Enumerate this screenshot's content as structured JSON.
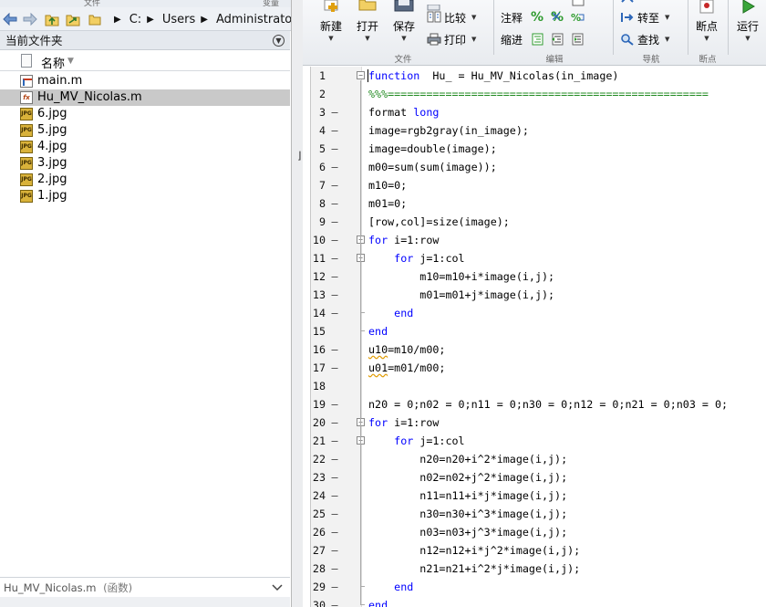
{
  "browser": {
    "top_labels": [
      "文件",
      "变量"
    ],
    "path": [
      "C:",
      "Users",
      "Administrator",
      "D"
    ],
    "folder_header": "当前文件夹",
    "column_name": "名称",
    "files": [
      {
        "name": "main.m",
        "icon": "m-file-icon",
        "selected": false
      },
      {
        "name": "Hu_MV_Nicolas.m",
        "icon": "function-file-icon",
        "selected": true
      },
      {
        "name": "6.jpg",
        "icon": "jpg-file-icon",
        "selected": false
      },
      {
        "name": "5.jpg",
        "icon": "jpg-file-icon",
        "selected": false
      },
      {
        "name": "4.jpg",
        "icon": "jpg-file-icon",
        "selected": false
      },
      {
        "name": "3.jpg",
        "icon": "jpg-file-icon",
        "selected": false
      },
      {
        "name": "2.jpg",
        "icon": "jpg-file-icon",
        "selected": false
      },
      {
        "name": "1.jpg",
        "icon": "jpg-file-icon",
        "selected": false
      }
    ],
    "details_name": "Hu_MV_Nicolas.m",
    "details_type": "(函数)"
  },
  "ribbon": {
    "new_label": "新建",
    "open_label": "打开",
    "save_label": "保存",
    "compare_label": "比较",
    "print_label": "打印",
    "comment_label": "注释",
    "indent_label": "缩进",
    "goto_label": "转至",
    "find_label": "查找",
    "breakpoints_label": "断点",
    "run_label": "运行",
    "group_file": "文件",
    "group_edit": "编辑",
    "group_nav": "导航",
    "group_bp": "断点",
    "percent_glyph": "%"
  },
  "icons": {
    "back": "back-arrow-icon",
    "forward": "forward-arrow-icon",
    "up": "up-folder-icon",
    "browse": "browse-folder-icon",
    "folder": "folder-icon"
  },
  "code": [
    {
      "n": "1",
      "bp": "",
      "fold": "box",
      "t": [
        [
          "kw",
          "function"
        ],
        [
          "",
          "  Hu_ = Hu_MV_Nicolas(in_image)"
        ]
      ]
    },
    {
      "n": "2",
      "bp": "",
      "fold": "line",
      "t": [
        [
          "cm",
          "%%%=================================================="
        ]
      ]
    },
    {
      "n": "3",
      "bp": "–",
      "fold": "line",
      "t": [
        [
          "",
          "format "
        ],
        [
          "kw",
          "long"
        ]
      ]
    },
    {
      "n": "4",
      "bp": "–",
      "fold": "line",
      "t": [
        [
          "",
          "image=rgb2gray(in_image);"
        ]
      ]
    },
    {
      "n": "5",
      "bp": "–",
      "fold": "line",
      "t": [
        [
          "",
          "image=double(image);"
        ]
      ]
    },
    {
      "n": "6",
      "bp": "–",
      "fold": "line",
      "t": [
        [
          "",
          "m00=sum(sum(image));"
        ]
      ]
    },
    {
      "n": "7",
      "bp": "–",
      "fold": "line",
      "t": [
        [
          "",
          "m10=0;"
        ]
      ]
    },
    {
      "n": "8",
      "bp": "–",
      "fold": "line",
      "t": [
        [
          "",
          "m01=0;"
        ]
      ]
    },
    {
      "n": "9",
      "bp": "–",
      "fold": "line",
      "t": [
        [
          "",
          "[row,col]=size(image);"
        ]
      ]
    },
    {
      "n": "10",
      "bp": "–",
      "fold": "box",
      "t": [
        [
          "kw",
          "for"
        ],
        [
          "",
          " i=1:row"
        ]
      ]
    },
    {
      "n": "11",
      "bp": "–",
      "fold": "box",
      "t": [
        [
          "",
          "    "
        ],
        [
          "kw",
          "for"
        ],
        [
          "",
          " j=1:col"
        ]
      ]
    },
    {
      "n": "12",
      "bp": "–",
      "fold": "line",
      "t": [
        [
          "",
          "        m10=m10+i*image(i,j);"
        ]
      ]
    },
    {
      "n": "13",
      "bp": "–",
      "fold": "line",
      "t": [
        [
          "",
          "        m01=m01+j*image(i,j);"
        ]
      ]
    },
    {
      "n": "14",
      "bp": "–",
      "fold": "end",
      "t": [
        [
          "",
          "    "
        ],
        [
          "kw",
          "end"
        ]
      ]
    },
    {
      "n": "15",
      "bp": "",
      "fold": "end",
      "t": [
        [
          "kw",
          "end"
        ]
      ]
    },
    {
      "n": "16",
      "bp": "–",
      "fold": "line",
      "t": [
        [
          "sq",
          "u10"
        ],
        [
          "",
          "=m10/m00;"
        ]
      ]
    },
    {
      "n": "17",
      "bp": "–",
      "fold": "line",
      "t": [
        [
          "sq",
          "u01"
        ],
        [
          "",
          "=m01/m00;"
        ]
      ]
    },
    {
      "n": "18",
      "bp": "",
      "fold": "line",
      "t": []
    },
    {
      "n": "19",
      "bp": "–",
      "fold": "line",
      "t": [
        [
          "",
          "n20 = 0;n02 = 0;n11 = 0;n30 = 0;n12 = 0;n21 = 0;n03 = 0;"
        ]
      ]
    },
    {
      "n": "20",
      "bp": "–",
      "fold": "box",
      "t": [
        [
          "kw",
          "for"
        ],
        [
          "",
          " i=1:row"
        ]
      ]
    },
    {
      "n": "21",
      "bp": "–",
      "fold": "box",
      "t": [
        [
          "",
          "    "
        ],
        [
          "kw",
          "for"
        ],
        [
          "",
          " j=1:col"
        ]
      ]
    },
    {
      "n": "22",
      "bp": "–",
      "fold": "line",
      "t": [
        [
          "",
          "        n20=n20+i^2*image(i,j);"
        ]
      ]
    },
    {
      "n": "23",
      "bp": "–",
      "fold": "line",
      "t": [
        [
          "",
          "        n02=n02+j^2*image(i,j);"
        ]
      ]
    },
    {
      "n": "24",
      "bp": "–",
      "fold": "line",
      "t": [
        [
          "",
          "        n11=n11+i*j*image(i,j);"
        ]
      ]
    },
    {
      "n": "25",
      "bp": "–",
      "fold": "line",
      "t": [
        [
          "",
          "        n30=n30+i^3*image(i,j);"
        ]
      ]
    },
    {
      "n": "26",
      "bp": "–",
      "fold": "line",
      "t": [
        [
          "",
          "        n03=n03+j^3*image(i,j);"
        ]
      ]
    },
    {
      "n": "27",
      "bp": "–",
      "fold": "line",
      "t": [
        [
          "",
          "        n12=n12+i*j^2*image(i,j);"
        ]
      ]
    },
    {
      "n": "28",
      "bp": "–",
      "fold": "line",
      "t": [
        [
          "",
          "        n21=n21+i^2*j*image(i,j);"
        ]
      ]
    },
    {
      "n": "29",
      "bp": "–",
      "fold": "end",
      "t": [
        [
          "",
          "    "
        ],
        [
          "kw",
          "end"
        ]
      ]
    },
    {
      "n": "30",
      "bp": "–",
      "fold": "end",
      "t": [
        [
          "kw",
          "end"
        ]
      ]
    }
  ]
}
